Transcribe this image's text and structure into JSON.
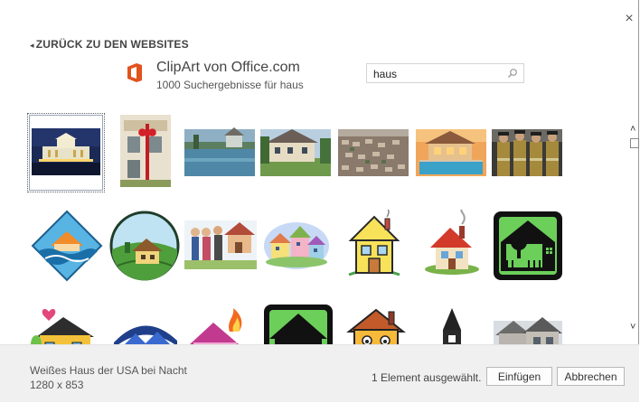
{
  "dialog": {
    "back_label": "ZURÜCK ZU DEN WEBSITES",
    "close_glyph": "×"
  },
  "source": {
    "title": "ClipArt von Office.com",
    "subtitle": "1000 Suchergebnisse für haus",
    "logo_icon": "office-logo-icon",
    "logo_color": "#e2521d"
  },
  "search": {
    "value": "haus",
    "icon": "search-icon"
  },
  "results": [
    {
      "name": "white-house-night"
    },
    {
      "name": "house-red-bow"
    },
    {
      "name": "flooded-street"
    },
    {
      "name": "suburban-house"
    },
    {
      "name": "aerial-neighborhood"
    },
    {
      "name": "house-with-pool"
    },
    {
      "name": "firefighters"
    },
    {
      "name": "flooded-house-clipart"
    },
    {
      "name": "house-on-globe-clipart"
    },
    {
      "name": "realtor-couple-clipart"
    },
    {
      "name": "colorful-houses-clipart"
    },
    {
      "name": "yellow-house-clipart"
    },
    {
      "name": "red-roof-house-clipart"
    },
    {
      "name": "green-house-tree-clipart"
    },
    {
      "name": "heart-house-clipart"
    },
    {
      "name": "blue-roof-houses-clipart"
    },
    {
      "name": "house-on-fire-clipart"
    },
    {
      "name": "house-dollar-clipart"
    },
    {
      "name": "house-face-clipart"
    },
    {
      "name": "dark-tower-clipart"
    },
    {
      "name": "grey-house-photo"
    }
  ],
  "scroll": {
    "up_glyph": "˄",
    "down_glyph": "˅"
  },
  "footer": {
    "selected_name": "Weißes Haus der USA bei Nacht",
    "selected_size": "1280 x 853",
    "status": "1 Element ausgewählt.",
    "insert_label": "Einfügen",
    "cancel_label": "Abbrechen"
  }
}
